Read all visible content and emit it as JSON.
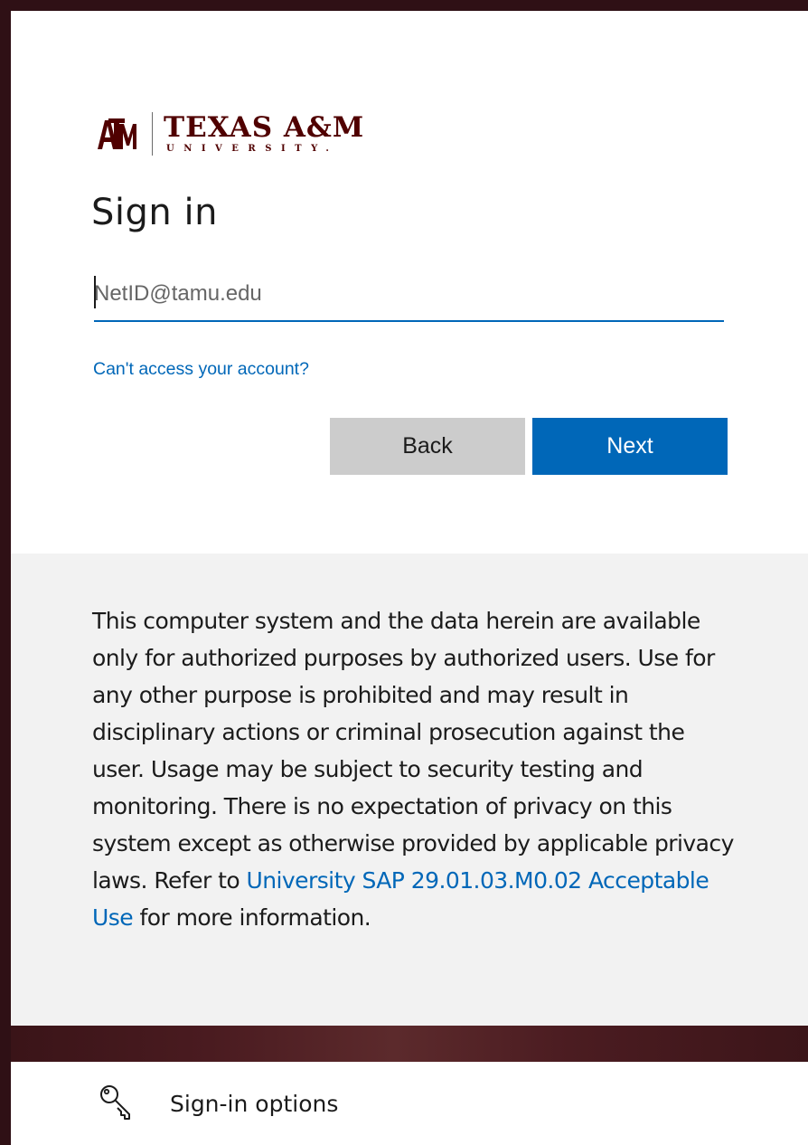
{
  "brand": {
    "name": "TEXAS A&M",
    "subtitle": "UNIVERSITY.",
    "color": "#500000"
  },
  "signin": {
    "title": "Sign in",
    "input_placeholder": "NetID@tamu.edu",
    "input_value": "",
    "cant_access_link": "Can't access your account?",
    "back_label": "Back",
    "next_label": "Next",
    "accent_color": "#0067b8"
  },
  "notice": {
    "text_before_link": "This computer system and the data herein are available only for authorized purposes by authorized users. Use for any other purpose is prohibited and may result in disciplinary actions or criminal prosecution against the user. Usage may be subject to security testing and monitoring. There is no expectation of privacy on this system except as otherwise provided by applicable privacy laws. Refer to ",
    "link_text": "University SAP 29.01.03.M0.02 Acceptable Use",
    "text_after_link": " for more information."
  },
  "options": {
    "icon": "key-icon",
    "label": "Sign-in options"
  }
}
